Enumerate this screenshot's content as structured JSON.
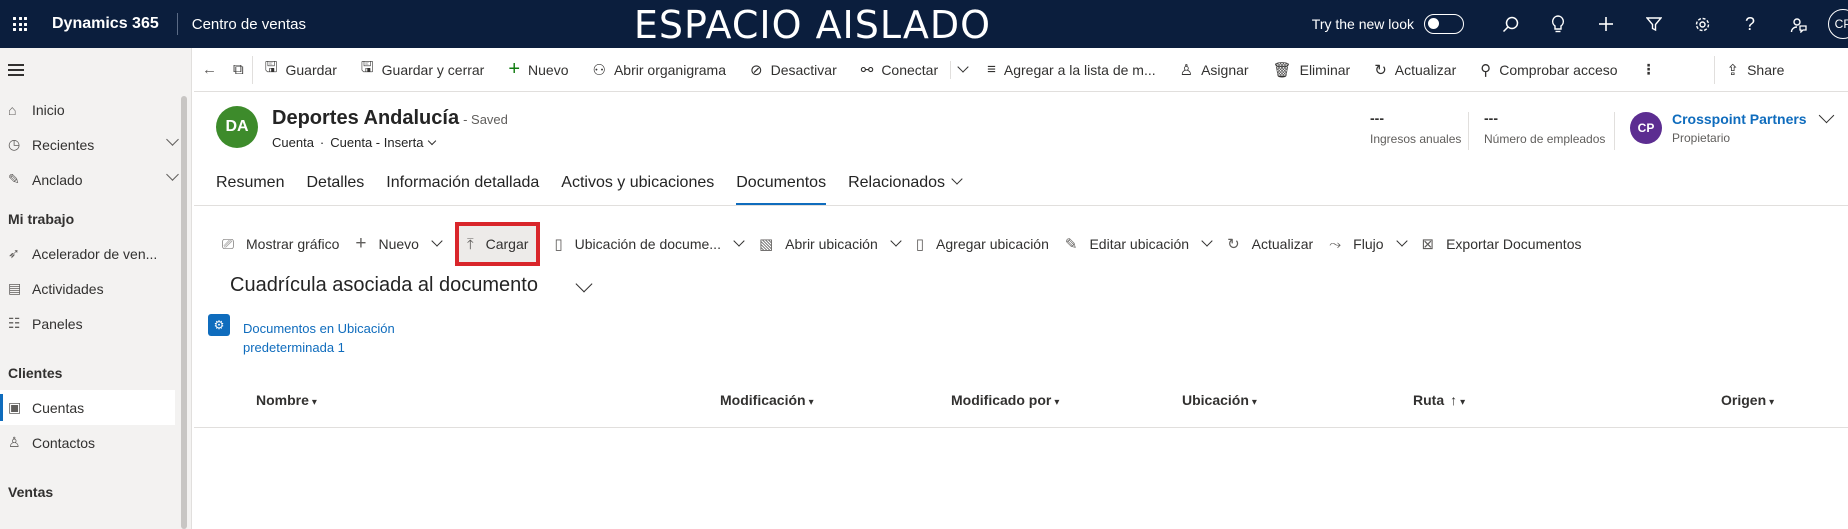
{
  "topbar": {
    "brand": "Dynamics 365",
    "app_name": "Centro de ventas",
    "environment_title": "ESPACIO AISLADO",
    "try_new_look": "Try the new look",
    "user_initials": "CP"
  },
  "sidebar": {
    "items": [
      {
        "label": "Inicio",
        "icon": "home-icon"
      },
      {
        "label": "Recientes",
        "icon": "clock-icon"
      },
      {
        "label": "Anclado",
        "icon": "pin-icon"
      }
    ],
    "section_mi_trabajo": "Mi trabajo",
    "work_items": [
      {
        "label": "Acelerador de ven...",
        "icon": "rocket-icon"
      },
      {
        "label": "Actividades",
        "icon": "clipboard-icon"
      },
      {
        "label": "Paneles",
        "icon": "dashboard-icon"
      }
    ],
    "section_clientes": "Clientes",
    "client_items": [
      {
        "label": "Cuentas",
        "icon": "account-icon"
      },
      {
        "label": "Contactos",
        "icon": "person-icon"
      }
    ],
    "section_ventas": "Ventas"
  },
  "commandbar": {
    "guardar": "Guardar",
    "guardar_cerrar": "Guardar y cerrar",
    "nuevo": "Nuevo",
    "organigrama": "Abrir organigrama",
    "desactivar": "Desactivar",
    "conectar": "Conectar",
    "agregar_lista": "Agregar a la lista de m...",
    "asignar": "Asignar",
    "eliminar": "Eliminar",
    "actualizar": "Actualizar",
    "comprobar": "Comprobar acceso",
    "share": "Share"
  },
  "record": {
    "initials": "DA",
    "name": "Deportes Andalucía",
    "saved": "- Saved",
    "entity": "Cuenta",
    "form": "Cuenta - Inserta",
    "ingresos_value": "---",
    "ingresos_label": "Ingresos anuales",
    "empleados_value": "---",
    "empleados_label": "Número de empleados",
    "owner_initials": "CP",
    "owner_name": "Crosspoint Partners",
    "owner_role": "Propietario"
  },
  "tabs": [
    "Resumen",
    "Detalles",
    "Información detallada",
    "Activos y ubicaciones",
    "Documentos",
    "Relacionados"
  ],
  "subcommands": {
    "mostrar_grafico": "Mostrar gráfico",
    "nuevo": "Nuevo",
    "cargar": "Cargar",
    "ubicacion_doc": "Ubicación de docume...",
    "abrir_ubicacion": "Abrir ubicación",
    "agregar_ubicacion": "Agregar ubicación",
    "editar_ubicacion": "Editar ubicación",
    "actualizar": "Actualizar",
    "flujo": "Flujo",
    "exportar": "Exportar Documentos"
  },
  "grid": {
    "title": "Cuadrícula asociada al documento",
    "location_link_line1": "Documentos en Ubicación",
    "location_link_line2": "predeterminada 1",
    "columns": [
      "Nombre",
      "Modificación",
      "Modificado por",
      "Ubicación",
      "Ruta",
      "Origen"
    ]
  }
}
